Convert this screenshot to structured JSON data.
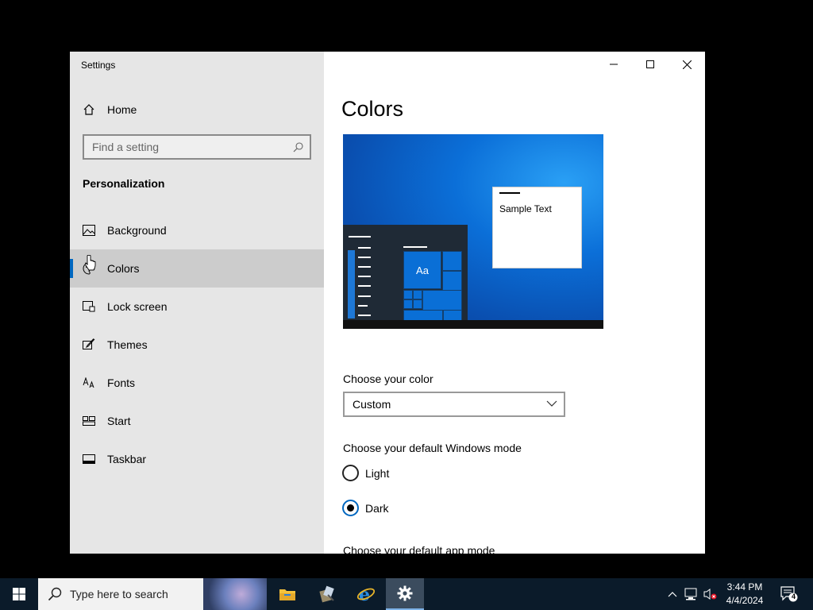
{
  "window": {
    "app_title": "Settings",
    "colors": {
      "accent": "#0067c0",
      "sidebar_bg": "#e6e6e6",
      "selected_bg": "#cccccc"
    }
  },
  "sidebar": {
    "home_label": "Home",
    "search_placeholder": "Find a setting",
    "section_title": "Personalization",
    "items": [
      {
        "label": "Background",
        "icon": "picture-icon",
        "selected": false
      },
      {
        "label": "Colors",
        "icon": "palette-icon",
        "selected": true
      },
      {
        "label": "Lock screen",
        "icon": "lock-screen-icon",
        "selected": false
      },
      {
        "label": "Themes",
        "icon": "brush-icon",
        "selected": false
      },
      {
        "label": "Fonts",
        "icon": "font-icon",
        "selected": false
      },
      {
        "label": "Start",
        "icon": "start-tiles-icon",
        "selected": false
      },
      {
        "label": "Taskbar",
        "icon": "taskbar-icon",
        "selected": false
      }
    ]
  },
  "main": {
    "title": "Colors",
    "preview": {
      "sample_text": "Sample Text",
      "tile_text": "Aa"
    },
    "choose_color": {
      "label": "Choose your color",
      "value": "Custom"
    },
    "windows_mode": {
      "label": "Choose your default Windows mode",
      "options": [
        {
          "label": "Light",
          "checked": false
        },
        {
          "label": "Dark",
          "checked": true
        }
      ]
    },
    "app_mode_label": "Choose your default app mode"
  },
  "taskbar": {
    "search_placeholder": "Type here to search",
    "apps": [
      "file-explorer-icon",
      "installer-icon",
      "internet-explorer-icon",
      "settings-gear-icon"
    ],
    "time": "3:44 PM",
    "date": "4/4/2024",
    "notification_count": "4"
  }
}
